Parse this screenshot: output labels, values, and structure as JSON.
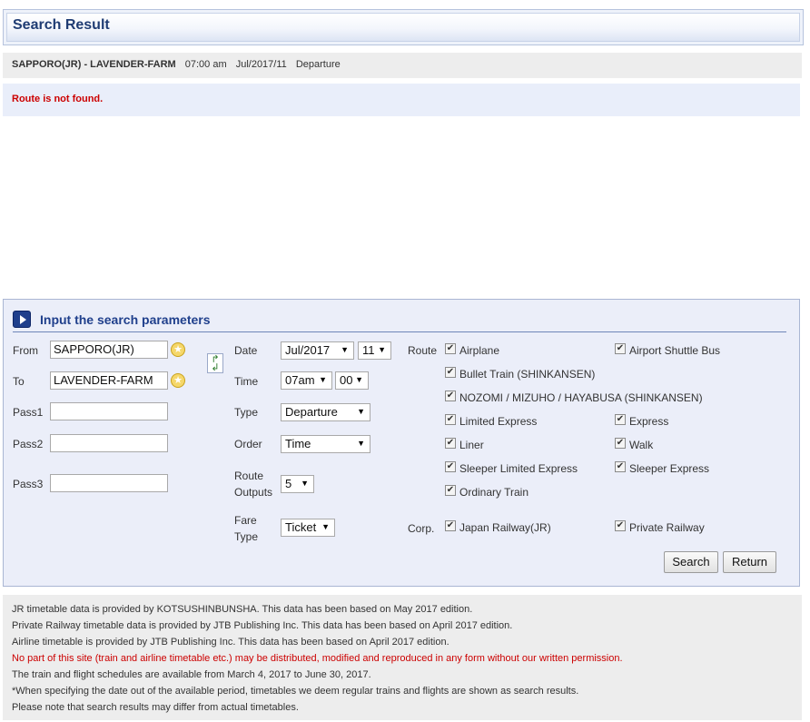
{
  "header": {
    "title": "Search Result"
  },
  "condition": {
    "route": "SAPPORO(JR) - LAVENDER-FARM",
    "time": "07:00 am",
    "date": "Jul/2017/11",
    "type": "Departure"
  },
  "error_message": "Route is not found.",
  "search_panel": {
    "title": "Input the search parameters",
    "from_label": "From",
    "from_value": "SAPPORO(JR)",
    "to_label": "To",
    "to_value": "LAVENDER-FARM",
    "pass1_label": "Pass1",
    "pass2_label": "Pass2",
    "pass3_label": "Pass3",
    "date_label": "Date",
    "date_month": "Jul/2017",
    "date_day": "11",
    "time_label": "Time",
    "time_hour": "07am",
    "time_minute": "00",
    "type_label": "Type",
    "type_value": "Departure",
    "order_label": "Order",
    "order_value": "Time",
    "route_outputs_label_1": "Route",
    "route_outputs_label_2": "Outputs",
    "route_outputs_value": "5",
    "fare_type_label_1": "Fare",
    "fare_type_label_2": "Type",
    "fare_type_value": "Ticket",
    "route_label": "Route",
    "routes": {
      "airplane": "Airplane",
      "airport_shuttle_bus": "Airport Shuttle Bus",
      "bullet_train": "Bullet Train (SHINKANSEN)",
      "nozomi": "NOZOMI / MIZUHO / HAYABUSA (SHINKANSEN)",
      "limited_express": "Limited Express",
      "express": "Express",
      "liner": "Liner",
      "walk": "Walk",
      "sleeper_limited_express": "Sleeper Limited Express",
      "sleeper_express": "Sleeper Express",
      "ordinary_train": "Ordinary Train"
    },
    "corp_label": "Corp.",
    "corps": {
      "jr": "Japan Railway(JR)",
      "private": "Private Railway"
    },
    "search_button": "Search",
    "return_button": "Return"
  },
  "footer": {
    "line1": "JR timetable data is provided by KOTSUSHINBUNSHA. This data has been based on May 2017 edition.",
    "line2": "Private Railway timetable data is provided by JTB Publishing Inc. This data has been based on April 2017 edition.",
    "line3": "Airline timetable is provided by JTB Publishing Inc. This data has been based on April 2017 edition.",
    "line4": "No part of this site (train and airline timetable etc.) may be distributed, modified and reproduced in any form without our written permission.",
    "line5": "The train and flight schedules are available from March 4, 2017 to June 30, 2017.",
    "line6": "*When specifying the date out of the available period, timetables we deem regular trains and flights are shown as search results.",
    "line7": "Please note that search results may differ from actual timetables."
  },
  "colors": {
    "accent": "#1f3f8c",
    "error": "#cc0000",
    "panel_bg": "#ebeef9"
  }
}
